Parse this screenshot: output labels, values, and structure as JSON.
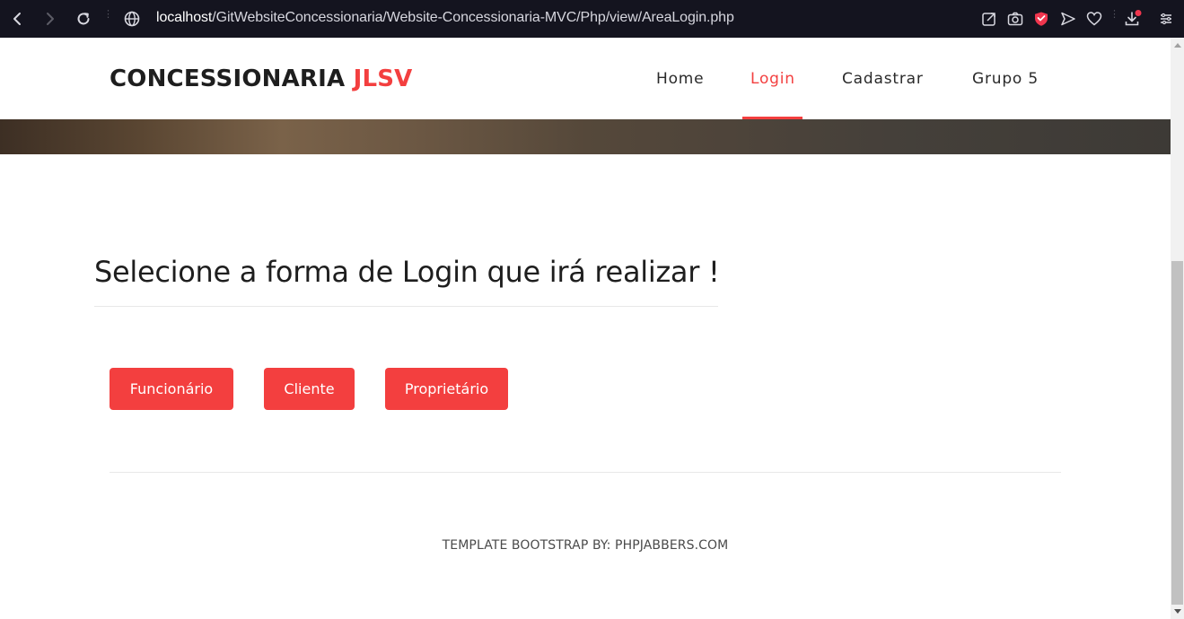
{
  "browser": {
    "url_host": "localhost",
    "url_path": "/GitWebsiteConcessionaria/Website-Concessionaria-MVC/Php/view/AreaLogin.php",
    "icons": [
      "back-icon",
      "forward-icon",
      "reload-icon",
      "site-info-icon",
      "share-icon",
      "camera-icon",
      "shield-icon",
      "send-icon",
      "heart-icon",
      "download-icon",
      "menu-icon"
    ],
    "accent_color": "#f33f3f"
  },
  "header": {
    "brand_main": "CONCESSIONARIA ",
    "brand_accent": "JLSV",
    "nav": [
      {
        "label": "Home",
        "active": false
      },
      {
        "label": "Login",
        "active": true
      },
      {
        "label": "Cadastrar",
        "active": false
      },
      {
        "label": "Grupo 5",
        "active": false
      }
    ]
  },
  "main": {
    "heading": "Selecione a forma de Login que irá realizar !",
    "buttons": [
      {
        "label": "Funcionário"
      },
      {
        "label": "Cliente"
      },
      {
        "label": "Proprietário"
      }
    ]
  },
  "footer": {
    "text": "TEMPLATE BOOTSTRAP BY: PHPJABBERS.COM"
  },
  "colors": {
    "primary": "#f33f3f",
    "text_dark": "#1e1e1e",
    "browser_bg": "#14141f"
  }
}
